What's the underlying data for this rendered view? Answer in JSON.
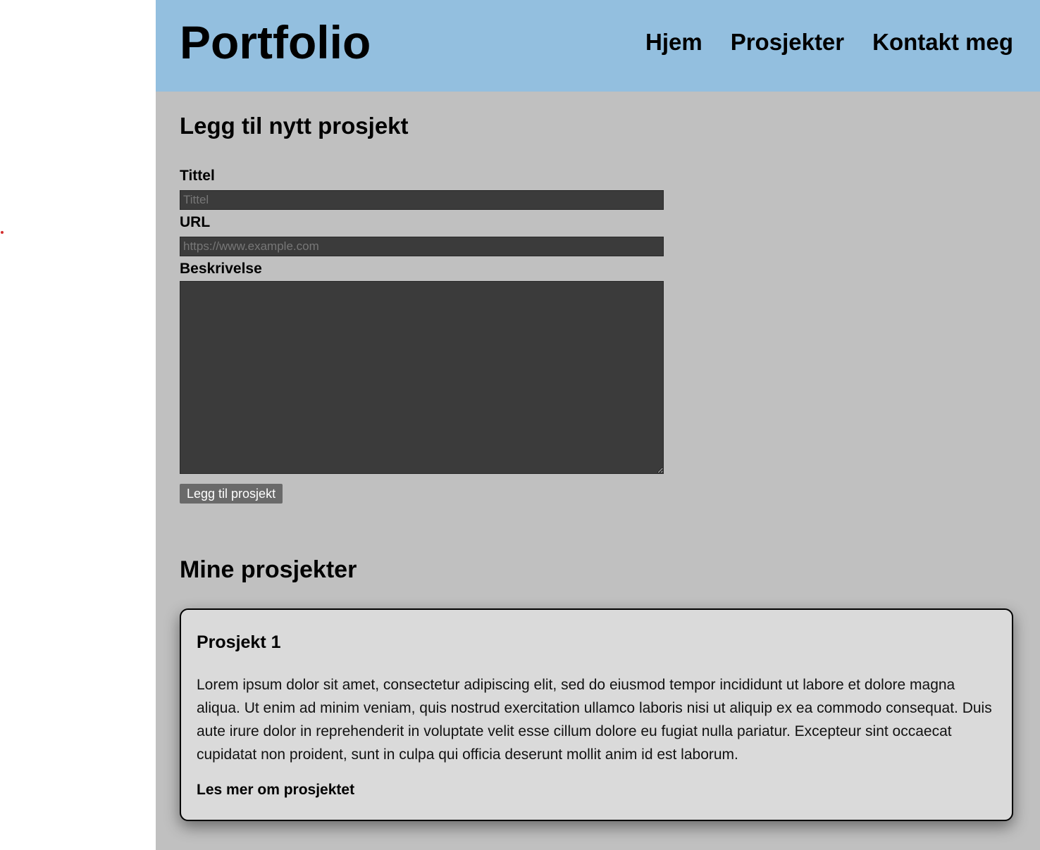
{
  "header": {
    "logo": "Portfolio",
    "nav": [
      "Hjem",
      "Prosjekter",
      "Kontakt meg"
    ]
  },
  "form": {
    "title": "Legg til nytt prosjekt",
    "title_label": "Tittel",
    "title_placeholder": "Tittel",
    "title_value": "",
    "url_label": "URL",
    "url_placeholder": "https://www.example.com",
    "url_value": "",
    "description_label": "Beskrivelse",
    "description_value": "",
    "submit_label": "Legg til prosjekt"
  },
  "projects": {
    "title": "Mine prosjekter",
    "items": [
      {
        "title": "Prosjekt 1",
        "description": "Lorem ipsum dolor sit amet, consectetur adipiscing elit, sed do eiusmod tempor incididunt ut labore et dolore magna aliqua. Ut enim ad minim veniam, quis nostrud exercitation ullamco laboris nisi ut aliquip ex ea commodo consequat. Duis aute irure dolor in reprehenderit in voluptate velit esse cillum dolore eu fugiat nulla pariatur. Excepteur sint occaecat cupidatat non proident, sunt in culpa qui officia deserunt mollit anim id est laborum.",
        "link": "Les mer om prosjektet"
      }
    ]
  },
  "colors": {
    "header_bg": "#93bfdf",
    "page_bg": "#c0c0c0",
    "input_bg": "#3b3b3b",
    "card_bg": "#dadada"
  }
}
